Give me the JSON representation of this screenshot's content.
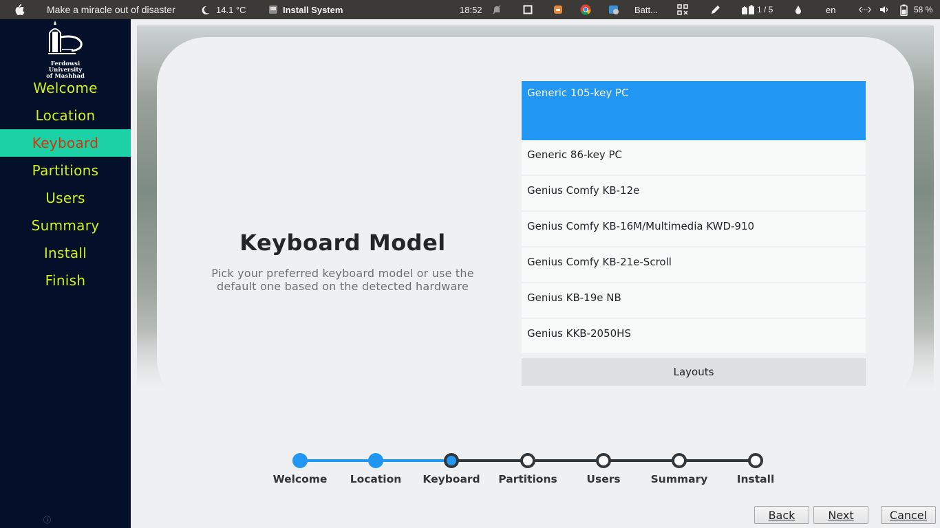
{
  "topbar": {
    "apple_icon": "apple-icon",
    "window_title": "Make a miracle out of disaster",
    "weather": "14.1 °C",
    "task_title": "Install System",
    "clock": "18:52",
    "battery_label": "Batt...",
    "workspace": "1 / 5",
    "lang": "en",
    "battery_percent": "58 %"
  },
  "sidebar": {
    "logo_line1": "Ferdowsi University",
    "logo_line2": "of Mashhad",
    "items": [
      {
        "label": "Welcome"
      },
      {
        "label": "Location"
      },
      {
        "label": "Keyboard"
      },
      {
        "label": "Partitions"
      },
      {
        "label": "Users"
      },
      {
        "label": "Summary"
      },
      {
        "label": "Install"
      },
      {
        "label": "Finish"
      }
    ],
    "active_index": 2,
    "info_glyph": "ⓘ"
  },
  "main": {
    "title": "Keyboard Model",
    "subtitle_line1": "Pick your preferred keyboard model or use the",
    "subtitle_line2": "default one based on the detected hardware",
    "models": [
      "Generic 105-key PC",
      "Generic 86-key PC",
      "Genius Comfy KB-12e",
      "Genius Comfy KB-16M/Multimedia KWD-910",
      "Genius Comfy KB-21e-Scroll",
      "Genius KB-19e NB",
      "Genius KKB-2050HS"
    ],
    "selected_model_index": 0,
    "layouts_button": "Layouts"
  },
  "progress": {
    "steps": [
      {
        "label": "Welcome",
        "state": "done"
      },
      {
        "label": "Location",
        "state": "done"
      },
      {
        "label": "Keyboard",
        "state": "current"
      },
      {
        "label": "Partitions",
        "state": "todo"
      },
      {
        "label": "Users",
        "state": "todo"
      },
      {
        "label": "Summary",
        "state": "todo"
      },
      {
        "label": "Install",
        "state": "todo"
      }
    ]
  },
  "buttons": {
    "back": "Back",
    "next": "Next",
    "cancel": "Cancel"
  },
  "colors": {
    "accent": "#2196f3",
    "sidebar_bg": "#04102a",
    "sidebar_text": "#d1ef1b",
    "sidebar_active_bg": "#1bd1a5",
    "sidebar_active_text": "#d5340b"
  }
}
